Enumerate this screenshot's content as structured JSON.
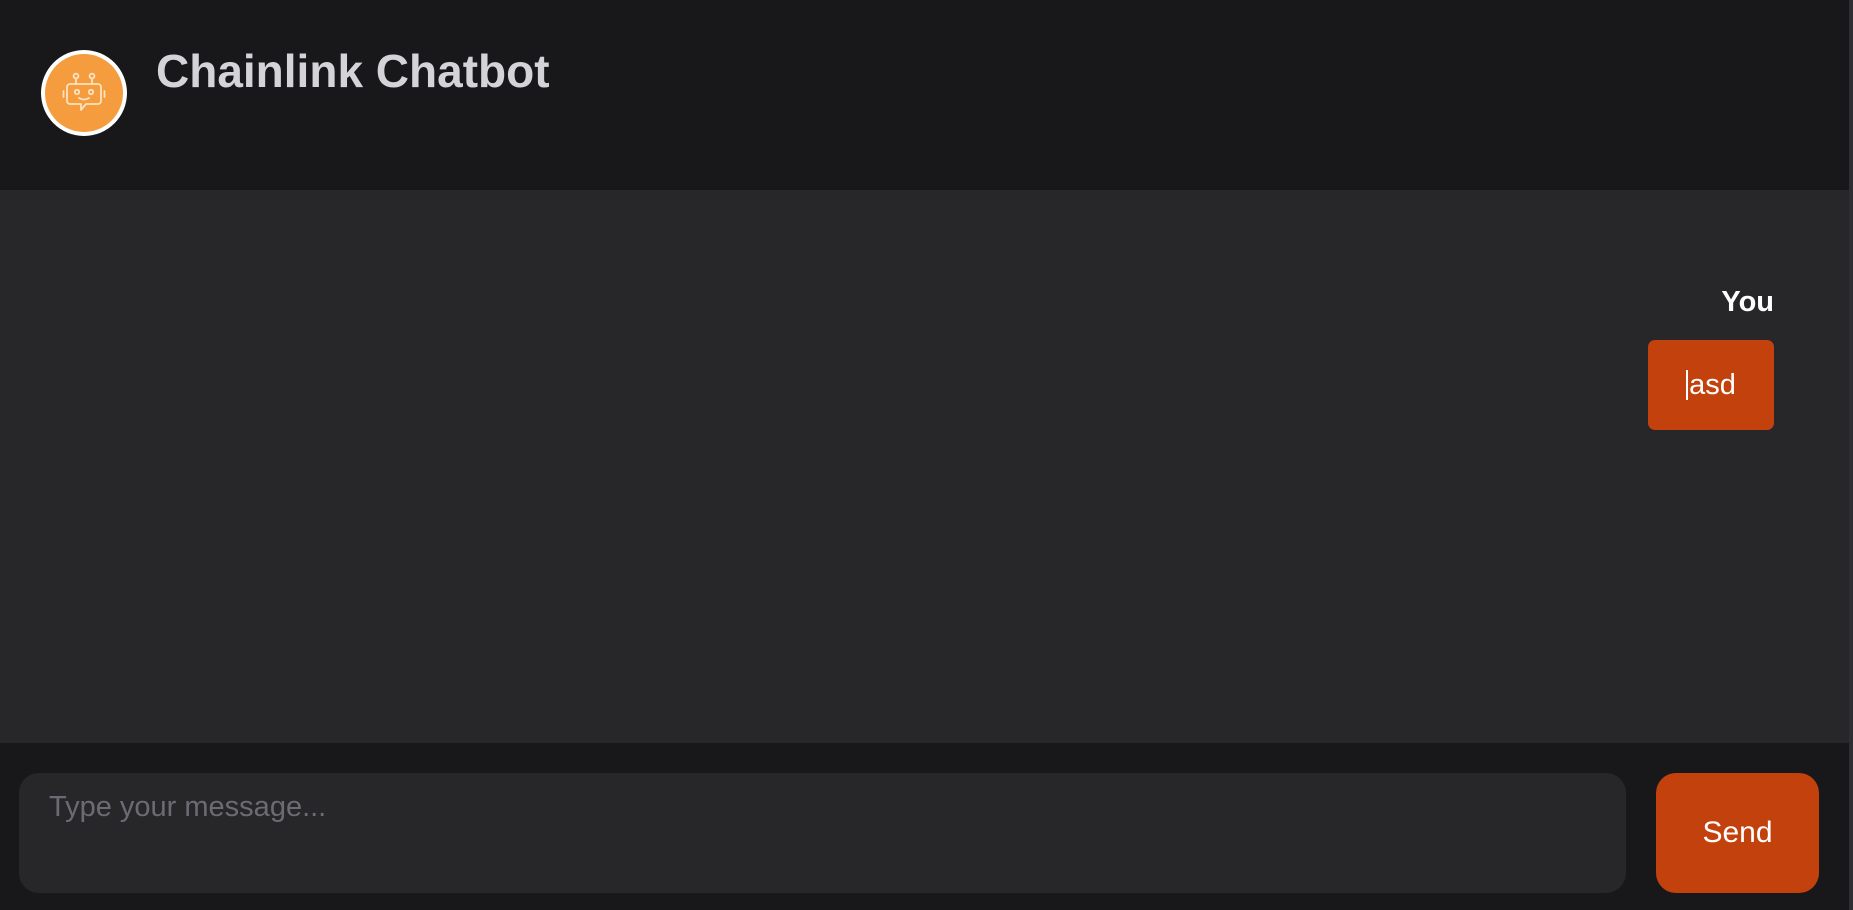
{
  "header": {
    "title": "Chainlink Chatbot",
    "logo_icon": "robot-icon"
  },
  "chat": {
    "messages": [
      {
        "sender": "You",
        "text": "asd"
      }
    ]
  },
  "composer": {
    "placeholder": "Type your message...",
    "value": "",
    "send_label": "Send"
  },
  "colors": {
    "background": "#18181b",
    "chat_background": "#27272a",
    "accent": "#c2410c",
    "logo": "#f59c3e",
    "title_text": "#d4d4d8",
    "placeholder_text": "#6b6b73"
  }
}
